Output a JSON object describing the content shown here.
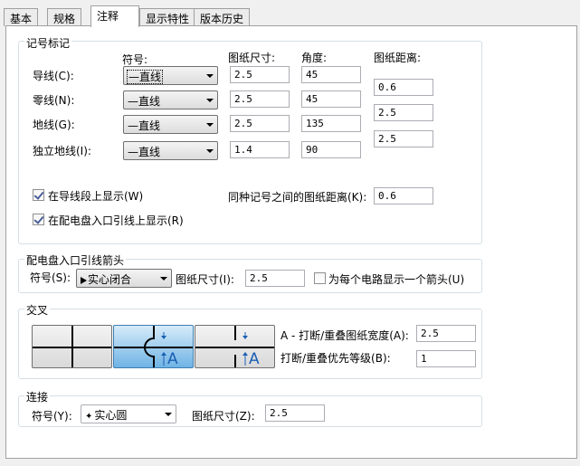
{
  "tabs": [
    "基本",
    "规格",
    "注释",
    "显示特性",
    "版本历史"
  ],
  "active_tab": 2,
  "mark_group": {
    "title": "记号标记",
    "headers": {
      "symbol": "符号:",
      "size": "图纸尺寸:",
      "angle": "角度:",
      "distance": "图纸距离:"
    },
    "rows": [
      {
        "label": "导线(C):",
        "symbol": "—直线",
        "size": "2.5",
        "angle": "45"
      },
      {
        "label": "零线(N):",
        "symbol": "—直线",
        "size": "2.5",
        "angle": "45"
      },
      {
        "label": "地线(G):",
        "symbol": "—直线",
        "size": "2.5",
        "angle": "135"
      },
      {
        "label": "独立地线(I):",
        "symbol": "—直线",
        "size": "1.4",
        "angle": "90"
      }
    ],
    "distances": [
      "0.6",
      "2.5",
      "2.5"
    ],
    "show_on_segment": {
      "label": "在导线段上显示(W)",
      "checked": true
    },
    "show_on_homerun": {
      "label": "在配电盘入口引线上显示(R)",
      "checked": true
    },
    "same_mark_distance": {
      "label": "同种记号之间的图纸距离(K):",
      "value": "0.6"
    }
  },
  "homerun_group": {
    "title": "配电盘入口引线箭头",
    "symbol_label": "符号(S):",
    "symbol_value": "实心闭合",
    "size_label": "图纸尺寸(I):",
    "size_value": "2.5",
    "each_circuit": {
      "label": "为每个电路显示一个箭头(U)",
      "checked": false
    }
  },
  "cross_group": {
    "title": "交叉",
    "selected_style": 1,
    "width_label": "A - 打断/重叠图纸宽度(A):",
    "width_value": "2.5",
    "priority_label": "打断/重叠优先等级(B):",
    "priority_value": "1",
    "glyph_letter": "A"
  },
  "connect_group": {
    "title": "连接",
    "symbol_label": "符号(Y):",
    "symbol_value": "实心圆",
    "size_label": "图纸尺寸(Z):",
    "size_value": "2.5"
  },
  "colors": {
    "selected_button": "#6fb3e5",
    "glyph": "#1a5fb4",
    "check": "#4a5f97"
  }
}
